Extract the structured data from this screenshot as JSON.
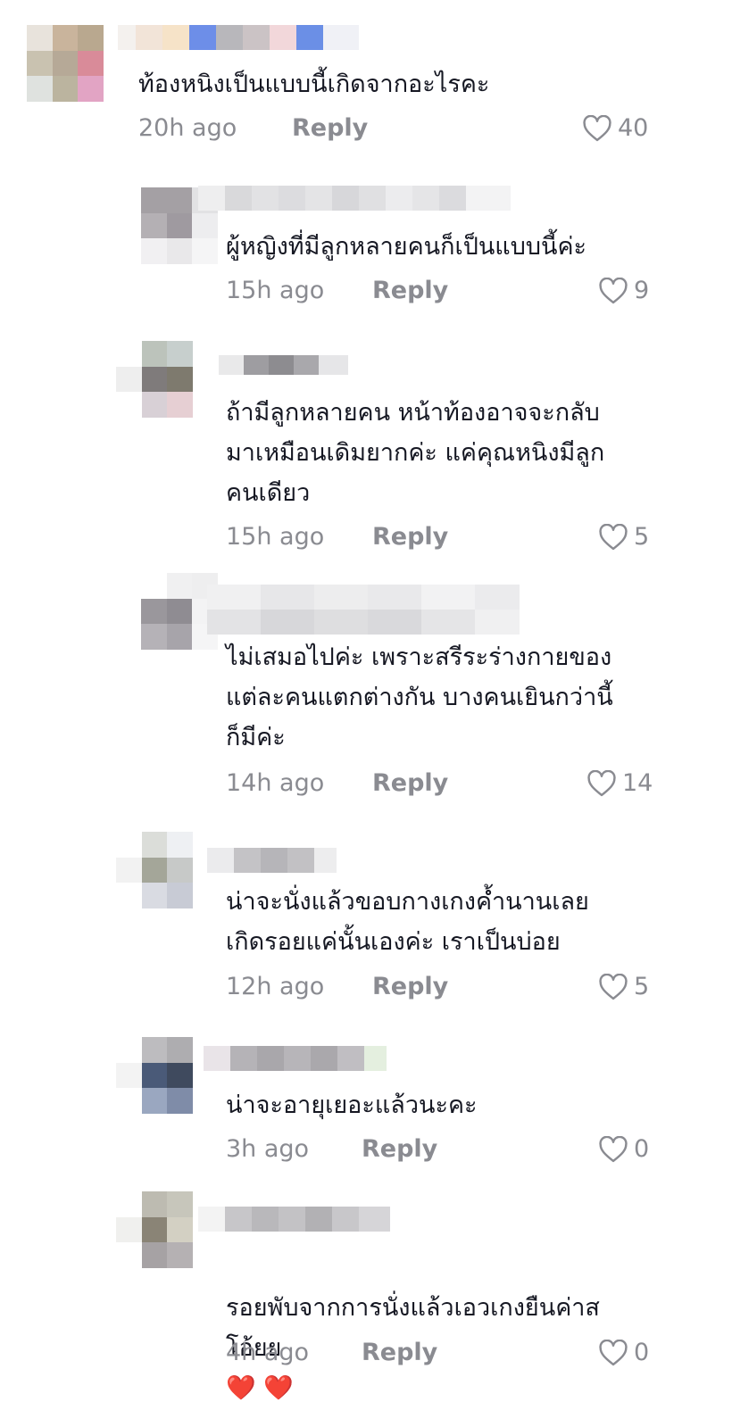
{
  "comments": [
    {
      "text": "ท้องหนิงเป็นแบบนี้เกิดจากอะไรคะ",
      "time": "20h ago",
      "reply_label": "Reply",
      "likes": "40"
    },
    {
      "text": "ผู้หญิงที่มีลูกหลายคนก็เป็นแบบนี้ค่ะ",
      "time": "15h ago",
      "reply_label": "Reply",
      "likes": "9"
    },
    {
      "text": "ถ้ามีลูกหลายคน หน้าท้องอาจจะกลับ\nมาเหมือนเดิมยากค่ะ แค่คุณหนิงมีลูก\nคนเดียว",
      "time": "15h ago",
      "reply_label": "Reply",
      "likes": "5"
    },
    {
      "text": "ไม่เสมอไปค่ะ เพราะสรีระร่างกายของ\nแต่ละคนแตกต่างกัน บางคนเยินกว่านี้\nก็มีค่ะ",
      "time": "14h ago",
      "reply_label": "Reply",
      "likes": "14"
    },
    {
      "text": "น่าจะนั่งแล้วขอบกางเกงค้ำนานเลย\nเกิดรอยแค่นั้นเองค่ะ เราเป็นบ่อย",
      "time": "12h ago",
      "reply_label": "Reply",
      "likes": "5"
    },
    {
      "text": "น่าจะอายุเยอะแล้วนะคะ",
      "time": "3h ago",
      "reply_label": "Reply",
      "likes": "0"
    },
    {
      "text": "รอยพับจากการนั่งแล้วเอวเกงยืนค่าส\nโอ้ยย",
      "emoji": "❤️ ❤️",
      "time": "4h ago",
      "reply_label": "Reply",
      "likes": "0"
    }
  ],
  "colors": {
    "text": "#161823",
    "meta": "#8a8b91",
    "heart_emoji": "#e8264a"
  },
  "icons": {
    "like": "heart-outline-icon",
    "avatar": "pixelated-avatar",
    "username": "pixelated-username"
  }
}
